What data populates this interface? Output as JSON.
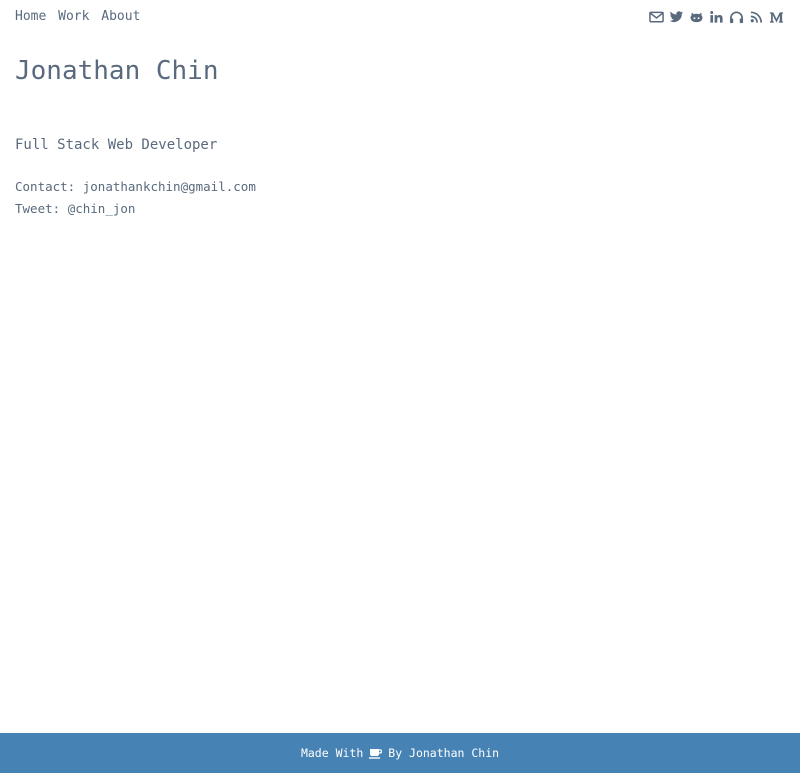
{
  "nav": {
    "links": [
      "Home",
      "Work",
      "About"
    ]
  },
  "social": {
    "icons": [
      "envelope-icon",
      "twitter-icon",
      "github-icon",
      "linkedin-icon",
      "headphones-icon",
      "rss-icon",
      "medium-icon"
    ],
    "color": "#5a6a7e"
  },
  "profile": {
    "name": "Jonathan Chin",
    "role": "Full Stack Web Developer",
    "contact_label": "Contact:",
    "contact_value": "jonathankchin@gmail.com",
    "tweet_label": "Tweet:",
    "tweet_value": "@chin_jon"
  },
  "footer": {
    "made_with": "Made With",
    "icon": "coffee-icon",
    "by": "By Jonathan Chin",
    "background": "#4682b4"
  }
}
